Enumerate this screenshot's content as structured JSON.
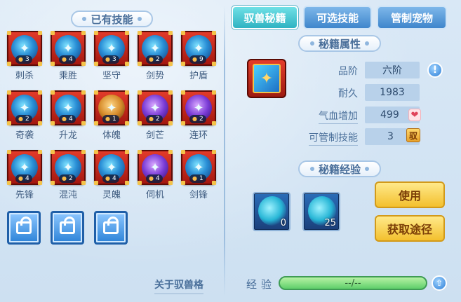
{
  "left": {
    "title": "已有技能",
    "skills": [
      {
        "label": "刺杀",
        "count": "3",
        "icon": "blue"
      },
      {
        "label": "乘胜",
        "count": "4",
        "icon": "blue"
      },
      {
        "label": "坚守",
        "count": "3",
        "icon": "blue"
      },
      {
        "label": "剑势",
        "count": "2",
        "icon": "blue"
      },
      {
        "label": "护盾",
        "count": "9",
        "icon": "blue"
      },
      {
        "label": "奇袭",
        "count": "2",
        "icon": "blue"
      },
      {
        "label": "升龙",
        "count": "4",
        "icon": "blue"
      },
      {
        "label": "体魄",
        "count": "1",
        "icon": "beast"
      },
      {
        "label": "剑芒",
        "count": "2",
        "icon": "purple"
      },
      {
        "label": "连环",
        "count": "2",
        "icon": "purple"
      },
      {
        "label": "先锋",
        "count": "4",
        "icon": "blue"
      },
      {
        "label": "混沌",
        "count": "2",
        "icon": "blue"
      },
      {
        "label": "灵魄",
        "count": "4",
        "icon": "blue"
      },
      {
        "label": "伺机",
        "count": "4",
        "icon": "purple"
      },
      {
        "label": "剑锋",
        "count": "1",
        "icon": "blue"
      }
    ],
    "link": "关于驭兽格"
  },
  "tabs": [
    "驭兽秘籍",
    "可选技能",
    "管制宠物"
  ],
  "attributes": {
    "title": "秘籍属性",
    "grade_label": "品阶",
    "grade_value": "六阶",
    "durability_label": "耐久",
    "durability_value": "1983",
    "hp_label": "气血增加",
    "hp_value": "499",
    "skills_label": "可管制技能",
    "skills_value": "3",
    "yu_badge": "驭"
  },
  "experience": {
    "title": "秘籍经验",
    "items": [
      {
        "count": "0"
      },
      {
        "count": "25"
      }
    ],
    "use_button": "使用",
    "obtain_button": "获取途径",
    "exp_label": "经验",
    "exp_value": "--/--"
  },
  "icons": {
    "info": "!",
    "heart": "❤",
    "up": "⇧"
  }
}
